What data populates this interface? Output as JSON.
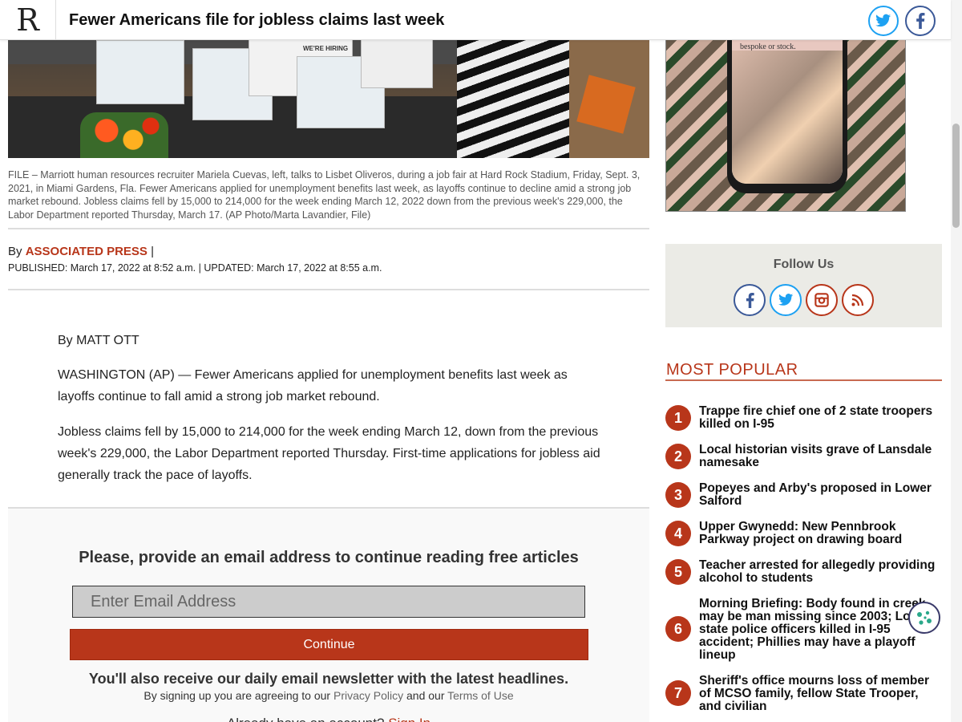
{
  "header": {
    "logo_letter": "R",
    "title": "Fewer Americans file for jobless claims last week",
    "share_icons": [
      "twitter-icon",
      "facebook-icon"
    ]
  },
  "photo": {
    "caption": "FILE – Marriott human resources recruiter Mariela Cuevas, left, talks to Lisbet Oliveros, during a job fair at Hard Rock Stadium, Friday, Sept. 3, 2021, in Miami Gardens, Fla. Fewer Americans applied for unemployment benefits last week, as layoffs continue to decline amid a strong job market rebound. Jobless claims fell by 15,000 to 214,000 for the week ending March 12, 2022 down from the previous week's 229,000, the Labor Department reported Thursday, March 17. (AP Photo/Marta Lavandier, File)",
    "sign_text": "WE'RE HIRING"
  },
  "meta": {
    "by_prefix": "By",
    "author_org": "ASSOCIATED PRESS",
    "separator": "|",
    "dates": "PUBLISHED: March 17, 2022 at 8:52 a.m. | UPDATED: March 17, 2022 at 8:55 a.m."
  },
  "article": {
    "byline": "By MATT OTT",
    "paragraphs": [
      "WASHINGTON (AP) — Fewer Americans applied for unemployment benefits last week as layoffs continue to fall amid a strong job market rebound.",
      "Jobless claims fell by 15,000 to 214,000 for the week ending March 12, down from the previous week's 229,000, the Labor Department reported Thursday. First-time applications for jobless aid generally track the pace of layoffs."
    ]
  },
  "paywall": {
    "heading": "Please, provide an email address to continue reading free articles",
    "email_placeholder": "Enter Email Address",
    "continue_label": "Continue",
    "newsletter_note": "You'll also receive our daily email newsletter with the latest headlines.",
    "legal_prefix": "By signing up you are agreeing to our",
    "privacy_label": "Privacy Policy",
    "legal_and": "and our",
    "terms_label": "Terms of Use",
    "signin_prefix": "Already have an account?",
    "signin_label": "Sign In"
  },
  "ad": {
    "phone_text": "bespoke or stock."
  },
  "follow": {
    "title": "Follow Us",
    "icons": [
      "facebook-icon",
      "twitter-icon",
      "instagram-icon",
      "rss-icon"
    ],
    "colors": {
      "facebook": "#3b5998",
      "twitter": "#1da1f2",
      "instagram": "#b8361a",
      "rss": "#b8361a"
    }
  },
  "most_popular": {
    "title": "MOST POPULAR",
    "items": [
      {
        "num": "1",
        "text": "Trappe fire chief one of 2 state troopers killed on I-95"
      },
      {
        "num": "2",
        "text": "Local historian visits grave of Lansdale namesake"
      },
      {
        "num": "3",
        "text": "Popeyes and Arby's proposed in Lower Salford"
      },
      {
        "num": "4",
        "text": "Upper Gwynedd: New Pennbrook Parkway project on drawing board"
      },
      {
        "num": "5",
        "text": "Teacher arrested for allegedly providing alcohol to students"
      },
      {
        "num": "6",
        "text": "Morning Briefing: Body found in creek may be man missing since 2003; Local state police officers killed in I-95 accident; Phillies may have a playoff lineup"
      },
      {
        "num": "7",
        "text": "Sheriff's office mourns loss of member of MCSO family, fellow State Trooper, and civilian"
      }
    ]
  },
  "colors": {
    "accent": "#b8361a",
    "follow_bg": "#ebebe6",
    "input_bg": "#cccccc"
  }
}
